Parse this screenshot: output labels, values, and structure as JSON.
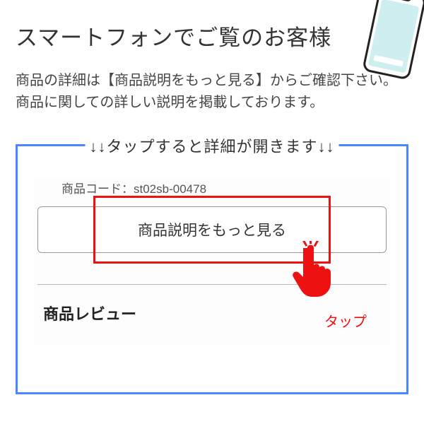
{
  "header": {
    "title": "スマートフォンでご覧のお客様"
  },
  "intro": {
    "line1": "商品の詳細は【商品説明をもっと見る】からご確認下さい。",
    "line2": "商品に関しての詳しい説明を掲載しております。"
  },
  "box": {
    "legend": "↓↓タップすると詳細が開きます↓↓",
    "product_code_label": "商品コード：",
    "product_code_value": "st02sb-00478",
    "button_label": "商品説明をもっと見る",
    "tap_label": "タップ",
    "review_heading": "商品レビュー"
  }
}
